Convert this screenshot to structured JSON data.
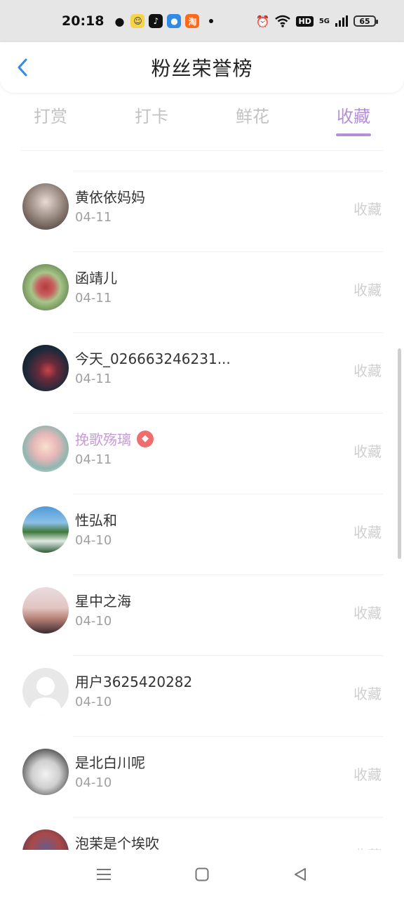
{
  "status": {
    "time": "20:18",
    "battery": "65",
    "network": "5G",
    "hd": "HD"
  },
  "header": {
    "title": "粉丝荣誉榜"
  },
  "tabs": [
    {
      "label": "打赏",
      "active": false
    },
    {
      "label": "打卡",
      "active": false
    },
    {
      "label": "鲜花",
      "active": false
    },
    {
      "label": "收藏",
      "active": true
    }
  ],
  "list": [
    {
      "name": "黄依依妈妈",
      "date": "04-11",
      "action": "收藏",
      "vip": false
    },
    {
      "name": "函靖儿",
      "date": "04-11",
      "action": "收藏",
      "vip": false
    },
    {
      "name": "今天_026663246231...",
      "date": "04-11",
      "action": "收藏",
      "vip": false
    },
    {
      "name": "挽歌殇璃",
      "date": "04-11",
      "action": "收藏",
      "vip": true
    },
    {
      "name": "性弘和",
      "date": "04-10",
      "action": "收藏",
      "vip": false
    },
    {
      "name": "星中之海",
      "date": "04-10",
      "action": "收藏",
      "vip": false
    },
    {
      "name": "用户3625420282",
      "date": "04-10",
      "action": "收藏",
      "vip": false
    },
    {
      "name": "是北白川呢",
      "date": "04-10",
      "action": "收藏",
      "vip": false
    },
    {
      "name": "泡茉是个埃吹",
      "date": "",
      "action": "收藏",
      "vip": false
    }
  ],
  "colors": {
    "accent": "#b58fd6",
    "vip_name": "#c79ad9",
    "back": "#2f8ae8"
  }
}
